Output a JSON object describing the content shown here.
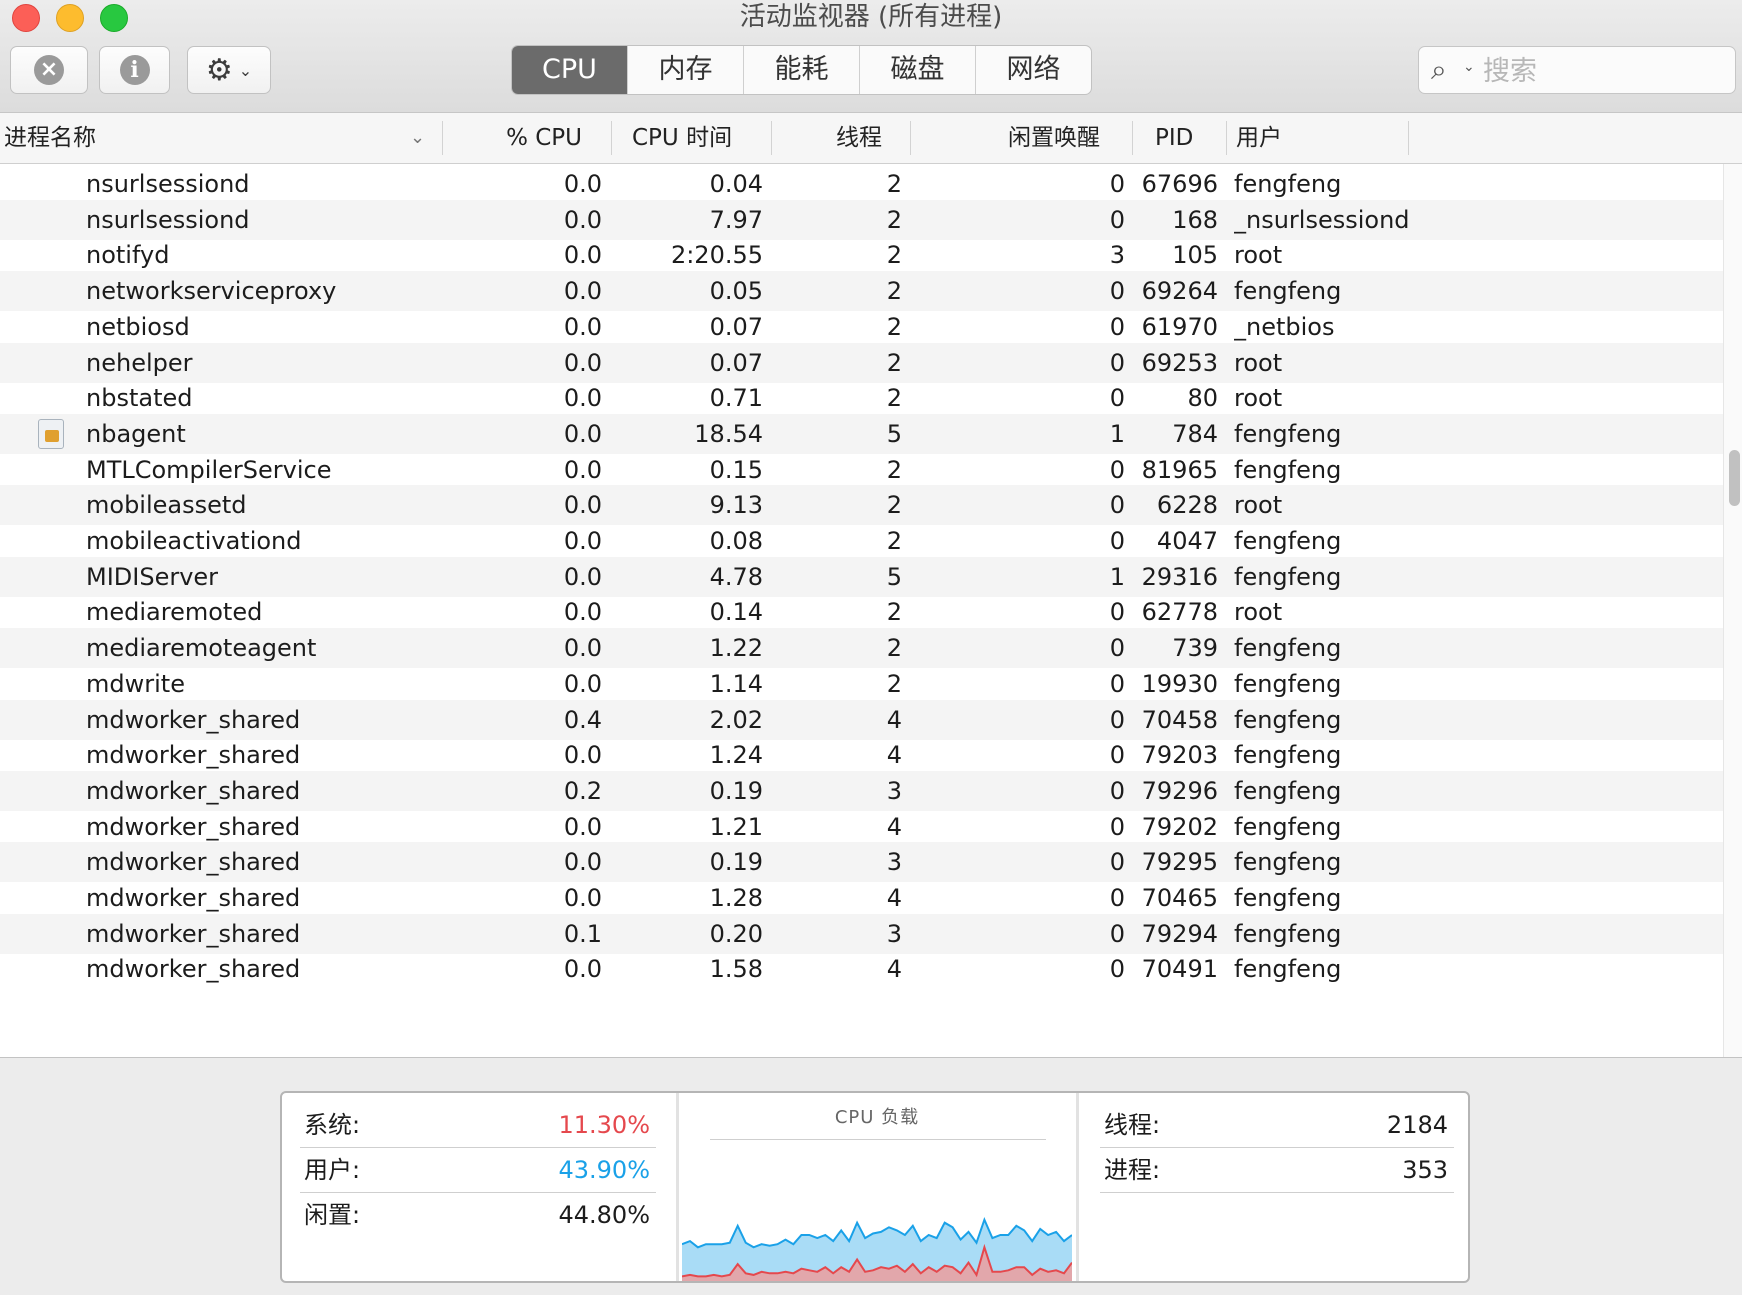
{
  "window": {
    "title": "活动监视器 (所有进程)"
  },
  "toolbar": {
    "stop_icon": "stop-process-icon",
    "info_icon": "info-icon",
    "gear_icon": "gear-icon",
    "tabs": [
      "CPU",
      "内存",
      "能耗",
      "磁盘",
      "网络"
    ],
    "active_tab": "CPU",
    "search_placeholder": "搜索"
  },
  "columns": {
    "name": "进程名称",
    "cpu": "% CPU",
    "cpu_time": "CPU 时间",
    "threads": "线程",
    "idle_wakeups": "闲置唤醒",
    "pid": "PID",
    "user": "用户"
  },
  "processes": [
    {
      "name": "nsurlsessiond",
      "cpu": "0.0",
      "time": "0.04",
      "threads": "2",
      "wakeups": "0",
      "pid": "67696",
      "user": "fengfeng"
    },
    {
      "name": "nsurlsessiond",
      "cpu": "0.0",
      "time": "7.97",
      "threads": "2",
      "wakeups": "0",
      "pid": "168",
      "user": "_nsurlsessiond"
    },
    {
      "name": "notifyd",
      "cpu": "0.0",
      "time": "2:20.55",
      "threads": "2",
      "wakeups": "3",
      "pid": "105",
      "user": "root"
    },
    {
      "name": "networkserviceproxy",
      "cpu": "0.0",
      "time": "0.05",
      "threads": "2",
      "wakeups": "0",
      "pid": "69264",
      "user": "fengfeng"
    },
    {
      "name": "netbiosd",
      "cpu": "0.0",
      "time": "0.07",
      "threads": "2",
      "wakeups": "0",
      "pid": "61970",
      "user": "_netbios"
    },
    {
      "name": "nehelper",
      "cpu": "0.0",
      "time": "0.07",
      "threads": "2",
      "wakeups": "0",
      "pid": "69253",
      "user": "root"
    },
    {
      "name": "nbstated",
      "cpu": "0.0",
      "time": "0.71",
      "threads": "2",
      "wakeups": "0",
      "pid": "80",
      "user": "root"
    },
    {
      "name": "nbagent",
      "cpu": "0.0",
      "time": "18.54",
      "threads": "5",
      "wakeups": "1",
      "pid": "784",
      "user": "fengfeng",
      "icon": "app-icon"
    },
    {
      "name": "MTLCompilerService",
      "cpu": "0.0",
      "time": "0.15",
      "threads": "2",
      "wakeups": "0",
      "pid": "81965",
      "user": "fengfeng"
    },
    {
      "name": "mobileassetd",
      "cpu": "0.0",
      "time": "9.13",
      "threads": "2",
      "wakeups": "0",
      "pid": "6228",
      "user": "root"
    },
    {
      "name": "mobileactivationd",
      "cpu": "0.0",
      "time": "0.08",
      "threads": "2",
      "wakeups": "0",
      "pid": "4047",
      "user": "fengfeng"
    },
    {
      "name": "MIDIServer",
      "cpu": "0.0",
      "time": "4.78",
      "threads": "5",
      "wakeups": "1",
      "pid": "29316",
      "user": "fengfeng"
    },
    {
      "name": "mediaremoted",
      "cpu": "0.0",
      "time": "0.14",
      "threads": "2",
      "wakeups": "0",
      "pid": "62778",
      "user": "root"
    },
    {
      "name": "mediaremoteagent",
      "cpu": "0.0",
      "time": "1.22",
      "threads": "2",
      "wakeups": "0",
      "pid": "739",
      "user": "fengfeng"
    },
    {
      "name": "mdwrite",
      "cpu": "0.0",
      "time": "1.14",
      "threads": "2",
      "wakeups": "0",
      "pid": "19930",
      "user": "fengfeng"
    },
    {
      "name": "mdworker_shared",
      "cpu": "0.4",
      "time": "2.02",
      "threads": "4",
      "wakeups": "0",
      "pid": "70458",
      "user": "fengfeng"
    },
    {
      "name": "mdworker_shared",
      "cpu": "0.0",
      "time": "1.24",
      "threads": "4",
      "wakeups": "0",
      "pid": "79203",
      "user": "fengfeng"
    },
    {
      "name": "mdworker_shared",
      "cpu": "0.2",
      "time": "0.19",
      "threads": "3",
      "wakeups": "0",
      "pid": "79296",
      "user": "fengfeng"
    },
    {
      "name": "mdworker_shared",
      "cpu": "0.0",
      "time": "1.21",
      "threads": "4",
      "wakeups": "0",
      "pid": "79202",
      "user": "fengfeng"
    },
    {
      "name": "mdworker_shared",
      "cpu": "0.0",
      "time": "0.19",
      "threads": "3",
      "wakeups": "0",
      "pid": "79295",
      "user": "fengfeng"
    },
    {
      "name": "mdworker_shared",
      "cpu": "0.0",
      "time": "1.28",
      "threads": "4",
      "wakeups": "0",
      "pid": "70465",
      "user": "fengfeng"
    },
    {
      "name": "mdworker_shared",
      "cpu": "0.1",
      "time": "0.20",
      "threads": "3",
      "wakeups": "0",
      "pid": "79294",
      "user": "fengfeng"
    },
    {
      "name": "mdworker_shared",
      "cpu": "0.0",
      "time": "1.58",
      "threads": "4",
      "wakeups": "0",
      "pid": "70491",
      "user": "fengfeng"
    }
  ],
  "summary": {
    "system_label": "系统:",
    "system_value": "11.30%",
    "user_label": "用户:",
    "user_value": "43.90%",
    "idle_label": "闲置:",
    "idle_value": "44.80%",
    "graph_title": "CPU 负载",
    "threads_label": "线程:",
    "threads_value": "2184",
    "processes_label": "进程:",
    "processes_value": "353"
  },
  "colors": {
    "system": "#e5484d",
    "user": "#1aa1e8",
    "active_tab": "#6b6b6b"
  },
  "cpu_load": {
    "user_pct": [
      24,
      26,
      22,
      24,
      24,
      24,
      25,
      36,
      25,
      22,
      24,
      23,
      24,
      27,
      24,
      30,
      30,
      28,
      30,
      26,
      33,
      26,
      38,
      28,
      31,
      32,
      35,
      33,
      30,
      36,
      26,
      30,
      28,
      38,
      35,
      27,
      32,
      25,
      40,
      28,
      30,
      30,
      36,
      33,
      26,
      34,
      30,
      32,
      26,
      30
    ],
    "system_pct": [
      3,
      4,
      3,
      3,
      4,
      3,
      4,
      11,
      5,
      4,
      6,
      5,
      5,
      6,
      5,
      8,
      7,
      6,
      9,
      5,
      9,
      6,
      14,
      6,
      7,
      9,
      8,
      10,
      6,
      11,
      5,
      9,
      6,
      10,
      9,
      5,
      12,
      4,
      22,
      6,
      6,
      7,
      9,
      9,
      4,
      8,
      6,
      7,
      5,
      12
    ]
  }
}
